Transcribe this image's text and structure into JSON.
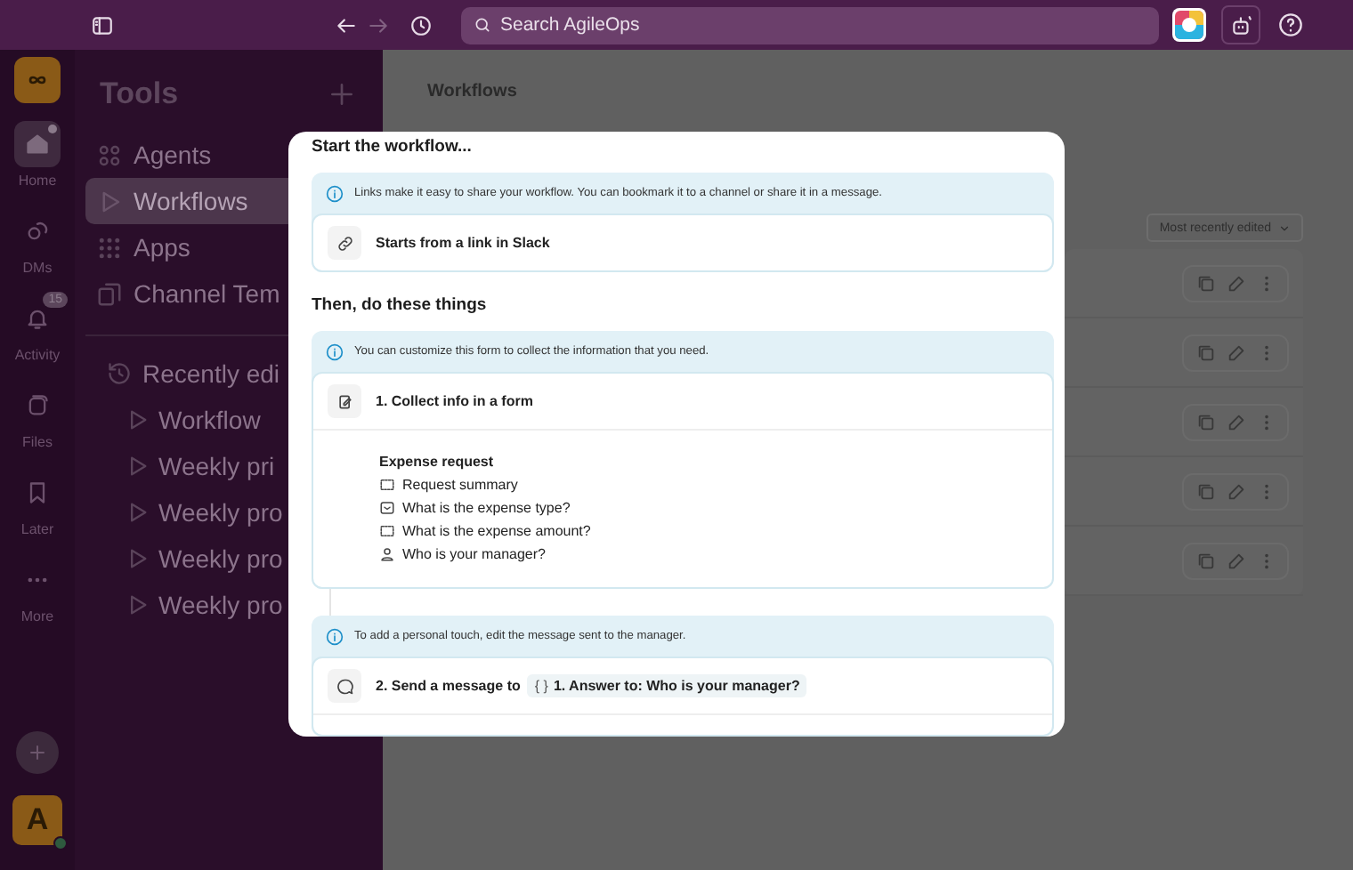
{
  "top_bar": {
    "search": {
      "placeholder": "Search AgileOps"
    },
    "forward_disabled": true
  },
  "rail": {
    "items": [
      {
        "label": "Home",
        "kind": "home",
        "selected": true,
        "dot": true
      },
      {
        "label": "DMs",
        "kind": "dms",
        "selected": false
      },
      {
        "label": "Activity",
        "kind": "activity",
        "selected": false,
        "badge": "15"
      },
      {
        "label": "Files",
        "kind": "files",
        "selected": false
      },
      {
        "label": "Later",
        "kind": "later",
        "selected": false
      },
      {
        "label": "More",
        "kind": "more",
        "selected": false
      }
    ],
    "avatar": "A"
  },
  "sidebar": {
    "title": "Tools",
    "items": [
      {
        "label": "Agents",
        "kind": "agents",
        "selected": false
      },
      {
        "label": "Workflows",
        "kind": "workflows",
        "selected": true
      },
      {
        "label": "Apps",
        "kind": "apps",
        "selected": false
      },
      {
        "label": "Channel Tem",
        "kind": "templates",
        "selected": false
      }
    ],
    "recent": {
      "label": "Recently edi",
      "items": [
        "Workflow",
        "Weekly pri",
        "Weekly pro",
        "Weekly pro",
        "Weekly pro"
      ]
    }
  },
  "main": {
    "title": "Workflows",
    "sort": "Most recently edited"
  },
  "modal": {
    "start_heading": "Start the workflow...",
    "trigger": {
      "info": "Links make it easy to share your workflow. You can bookmark it to a channel or share it in a message.",
      "label": "Starts from a link in Slack"
    },
    "steps_heading": "Then, do these things",
    "steps": [
      {
        "info": "You can customize this form to collect the information that you need.",
        "kind": "form",
        "label": "1. Collect info in a form",
        "form": {
          "title": "Expense request",
          "fields": [
            {
              "label": "Request summary",
              "kind": "text"
            },
            {
              "label": "What is the expense type?",
              "kind": "select"
            },
            {
              "label": "What is the expense amount?",
              "kind": "text"
            },
            {
              "label": "Who is your manager?",
              "kind": "user"
            }
          ]
        }
      },
      {
        "info": "To add a personal touch, edit the message sent to the manager.",
        "kind": "message",
        "label": "2. Send a message to",
        "chip_icon": "{ }",
        "chip": "1. Answer to: Who is your manager?"
      }
    ]
  }
}
